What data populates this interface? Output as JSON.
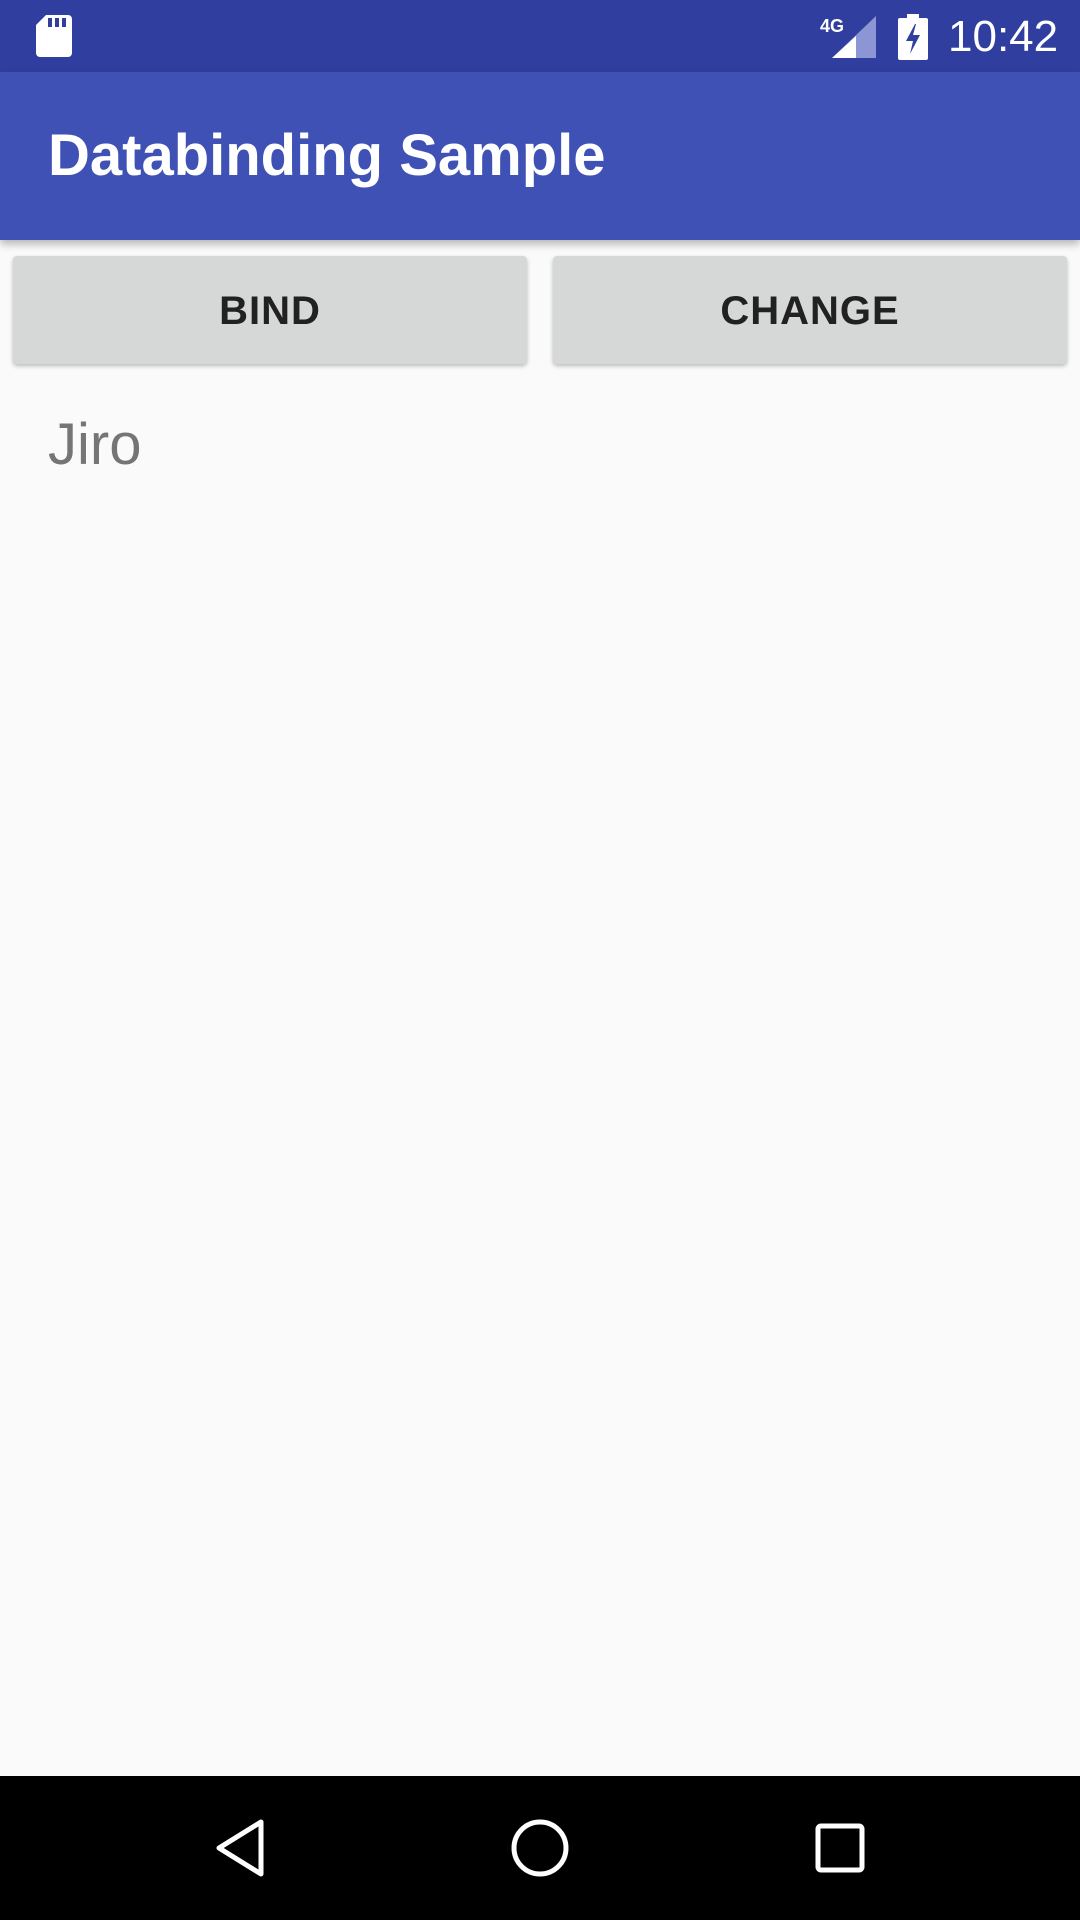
{
  "status_bar": {
    "time": "10:42",
    "network": "4G",
    "icons": [
      "sd-card-icon",
      "cellular-signal-icon",
      "battery-charging-icon"
    ]
  },
  "app_bar": {
    "title": "Databinding Sample",
    "color": "#3f51b5"
  },
  "buttons": {
    "bind_label": "BIND",
    "change_label": "CHANGE"
  },
  "main": {
    "name": "Jiro"
  },
  "nav_bar": {
    "icons": [
      "back-icon",
      "home-icon",
      "recent-apps-icon"
    ]
  },
  "colors": {
    "status_bar": "#303f9f",
    "app_bar": "#3f51b5",
    "button": "#d6d7d7",
    "background": "#fafafa"
  }
}
